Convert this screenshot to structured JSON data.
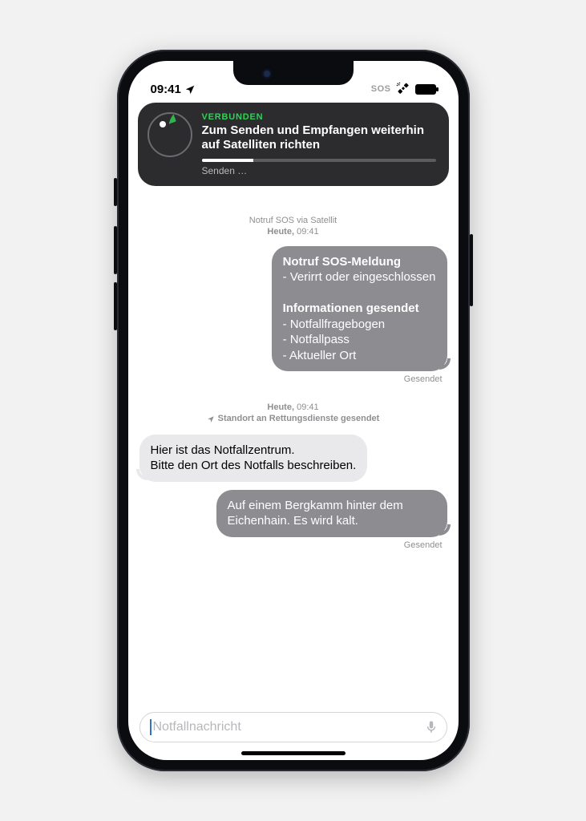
{
  "statusbar": {
    "time": "09:41",
    "sos": "SOS"
  },
  "banner": {
    "status": "VERBUNDEN",
    "message": "Zum Senden und Empfangen weiterhin auf Satelliten richten",
    "sending": "Senden …"
  },
  "thread_header": {
    "title": "Notruf SOS via Satellit",
    "day": "Heute,",
    "time": "09:41"
  },
  "first_msg": {
    "title1": "Notruf SOS-Meldung",
    "line1": "- Verirrt oder eingeschlossen",
    "title2": "Informationen gesendet",
    "line2": "- Notfallfragebogen",
    "line3": "- Notfallpass",
    "line4": "- Aktueller Ort",
    "receipt": "Gesendet"
  },
  "separator": {
    "day": "Heute,",
    "time": "09:41",
    "location_note": "Standort an Rettungsdienste gesendet"
  },
  "incoming": {
    "text": "Hier ist das Notfallzentrum.\nBitte den Ort des Notfalls beschreiben."
  },
  "reply": {
    "text": "Auf einem Bergkamm hinter dem Eichenhain. Es wird kalt.",
    "receipt": "Gesendet"
  },
  "input": {
    "placeholder": "Notfallnachricht"
  }
}
